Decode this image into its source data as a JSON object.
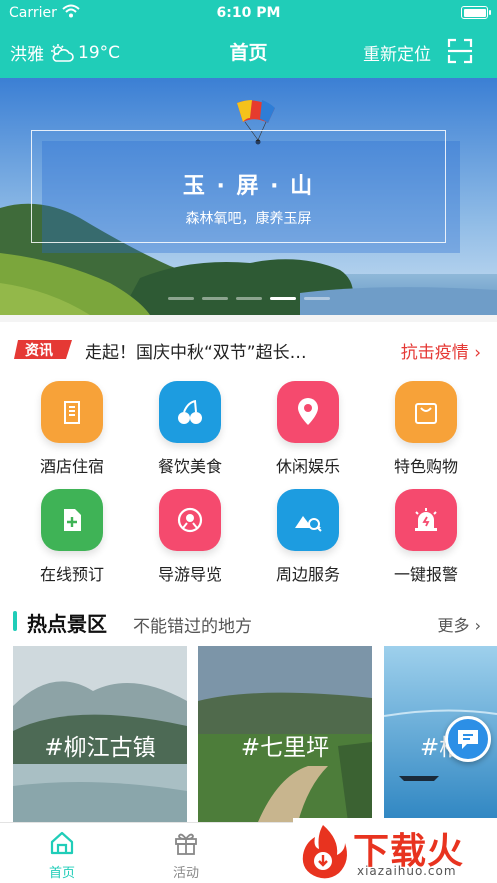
{
  "status_bar": {
    "carrier": "Carrier",
    "time": "6:10 PM"
  },
  "nav": {
    "location": "洪雅",
    "temperature": "19°C",
    "title": "首页",
    "relocate": "重新定位",
    "weather_icon": "partly-cloudy-icon",
    "scan_icon": "scan-icon"
  },
  "banner": {
    "title": "玉 · 屏 · 山",
    "subtitle": "森林氧吧，康养玉屏",
    "slide_count": 5,
    "active_slide": 4
  },
  "news": {
    "tag": "资讯",
    "headline": "走起！国庆中秋“双节”超长…",
    "link": "抗击疫情 ›"
  },
  "services": [
    {
      "label": "酒店住宿",
      "icon": "hotel-icon",
      "color": "#f7a239"
    },
    {
      "label": "餐饮美食",
      "icon": "cherry-icon",
      "color": "#1d9ce0"
    },
    {
      "label": "休闲娱乐",
      "icon": "location-icon",
      "color": "#f54a6e"
    },
    {
      "label": "特色购物",
      "icon": "shopping-bag-icon",
      "color": "#f7a239"
    },
    {
      "label": "在线预订",
      "icon": "booking-icon",
      "color": "#3fb356"
    },
    {
      "label": "导游导览",
      "icon": "map-guide-icon",
      "color": "#f54a6e"
    },
    {
      "label": "周边服务",
      "icon": "nearby-search-icon",
      "color": "#1d9ce0"
    },
    {
      "label": "一键报警",
      "icon": "alarm-icon",
      "color": "#f54a6e"
    }
  ],
  "hot_spots": {
    "title": "热点景区",
    "subtitle": "不能错过的地方",
    "more": "更多 ›",
    "items": [
      {
        "caption": "#柳江古镇"
      },
      {
        "caption": "#七里坪"
      },
      {
        "caption": "#槽"
      }
    ]
  },
  "tabs": [
    {
      "label": "首页",
      "active": true,
      "icon": "home-icon"
    },
    {
      "label": "活动",
      "active": false,
      "icon": "gift-icon"
    }
  ],
  "watermark": {
    "brand": "下载火",
    "url": "xiazaihuo.com"
  },
  "colors": {
    "accent": "#20cdb8",
    "alert": "#e53935"
  }
}
